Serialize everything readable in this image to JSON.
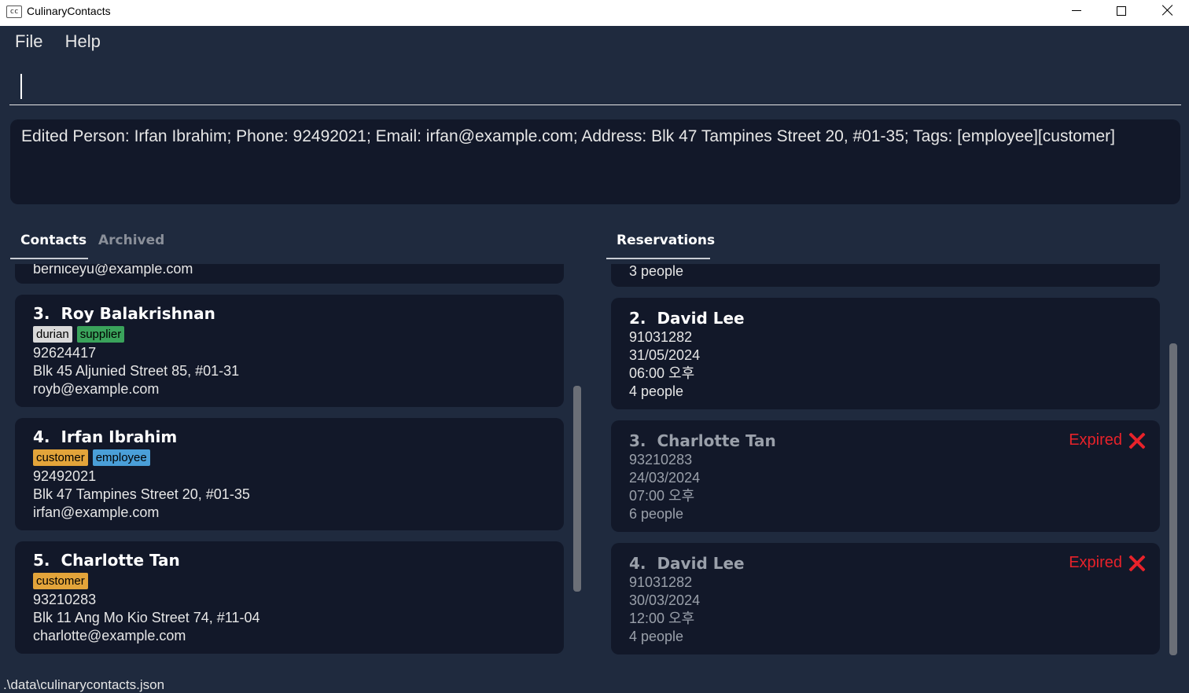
{
  "window": {
    "icon_text": "cc",
    "title": "CulinaryContacts"
  },
  "menu": {
    "file": "File",
    "help": "Help"
  },
  "command": {
    "value": ""
  },
  "result": {
    "text": "Edited Person: Irfan Ibrahim; Phone: 92492021; Email: irfan@example.com; Address: Blk 47 Tampines Street 20, #01-35; Tags: [employee][customer]"
  },
  "tabs": {
    "contacts": "Contacts",
    "archived": "Archived",
    "reservations": "Reservations"
  },
  "contacts": {
    "partial_email": "berniceyu@example.com",
    "items": [
      {
        "index": "3.",
        "name": "Roy Balakrishnan",
        "tags": [
          "durian",
          "supplier"
        ],
        "phone": "92624417",
        "address": "Blk 45 Aljunied Street 85, #01-31",
        "email": "royb@example.com"
      },
      {
        "index": "4.",
        "name": "Irfan Ibrahim",
        "tags": [
          "customer",
          "employee"
        ],
        "phone": "92492021",
        "address": "Blk 47 Tampines Street 20, #01-35",
        "email": "irfan@example.com"
      },
      {
        "index": "5.",
        "name": "Charlotte Tan",
        "tags": [
          "customer"
        ],
        "phone": "93210283",
        "address": "Blk 11 Ang Mo Kio Street 74, #11-04",
        "email": "charlotte@example.com"
      }
    ]
  },
  "reservations": {
    "partial_people": "3 people",
    "expired_label": "Expired",
    "items": [
      {
        "index": "2.",
        "name": "David Lee",
        "phone": "91031282",
        "date": "31/05/2024",
        "time": "06:00 오후",
        "people": "4 people",
        "expired": false
      },
      {
        "index": "3.",
        "name": "Charlotte Tan",
        "phone": "93210283",
        "date": "24/03/2024",
        "time": "07:00 오후",
        "people": "6 people",
        "expired": true
      },
      {
        "index": "4.",
        "name": "David Lee",
        "phone": "91031282",
        "date": "30/03/2024",
        "time": "12:00 오후",
        "people": "4 people",
        "expired": true
      }
    ]
  },
  "status": {
    "path": ".\\data\\culinarycontacts.json"
  }
}
